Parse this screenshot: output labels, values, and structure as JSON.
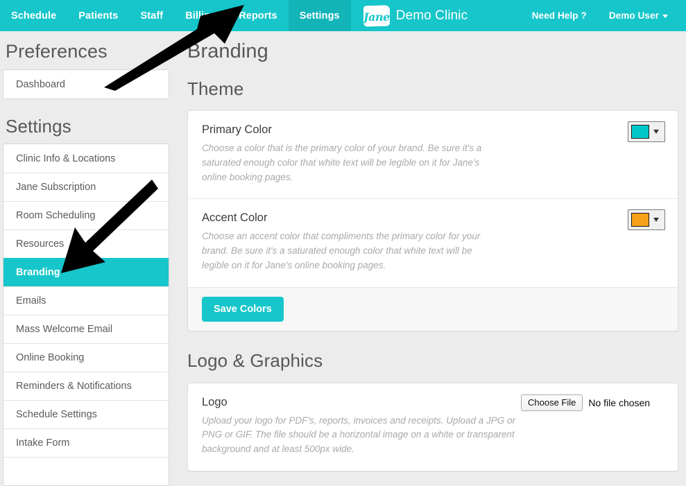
{
  "topnav": {
    "background_color": "#16c6ca",
    "active_background_color": "#12b4b8",
    "left_items": [
      {
        "label": "Schedule",
        "active": false
      },
      {
        "label": "Patients",
        "active": false
      },
      {
        "label": "Staff",
        "active": false
      },
      {
        "label": "Billing",
        "active": false
      },
      {
        "label": "Reports",
        "active": false
      },
      {
        "label": "Settings",
        "active": true
      }
    ],
    "brand": {
      "logo_text": "Jane",
      "clinic_name": "Demo Clinic"
    },
    "right_items": [
      {
        "label": "Need Help ?",
        "has_caret": false
      },
      {
        "label": "Demo User",
        "has_caret": true
      }
    ]
  },
  "sidebar": {
    "heading": "Preferences",
    "dashboard_group": [
      {
        "label": "Dashboard",
        "active": false
      }
    ],
    "settings_heading": "Settings",
    "settings_items": [
      {
        "label": "Clinic Info & Locations",
        "active": false
      },
      {
        "label": "Jane Subscription",
        "active": false
      },
      {
        "label": "Room Scheduling",
        "active": false
      },
      {
        "label": "Resources",
        "active": false
      },
      {
        "label": "Branding",
        "active": true
      },
      {
        "label": "Emails",
        "active": false
      },
      {
        "label": "Mass Welcome Email",
        "active": false
      },
      {
        "label": "Online Booking",
        "active": false
      },
      {
        "label": "Reminders & Notifications",
        "active": false
      },
      {
        "label": "Schedule Settings",
        "active": false
      },
      {
        "label": "Intake Form",
        "active": false
      },
      {
        "label": "",
        "active": false
      }
    ]
  },
  "main": {
    "page_title": "Branding",
    "theme": {
      "section_title": "Theme",
      "primary": {
        "title": "Primary Color",
        "description": "Choose a color that is the primary color of your brand. Be sure it's a saturated enough color that white text will be legible on it for Jane's online booking pages.",
        "color": "#00c8c8"
      },
      "accent": {
        "title": "Accent Color",
        "description": "Choose an accent color that compliments the primary color for your brand. Be sure it's a saturated enough color that white text will be legible on it for Jane's online booking pages.",
        "color": "#f9a01b"
      },
      "save_button": "Save Colors"
    },
    "logo_graphics": {
      "section_title": "Logo & Graphics",
      "logo": {
        "title": "Logo",
        "description": "Upload your logo for PDF's, reports, invoices and receipts. Upload a JPG or PNG or GIF. The file should be a horizontal image on a white or transparent background and at least 500px wide.",
        "choose_file_label": "Choose File",
        "file_status": "No file chosen"
      }
    }
  },
  "annotations": {
    "arrow_to_settings_tab": "black arrow pointing up-right at the Settings nav tab",
    "arrow_to_branding_item": "black arrow pointing down-left at the Branding sidebar item"
  }
}
